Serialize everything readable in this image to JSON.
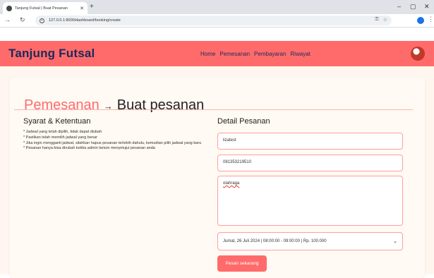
{
  "browser": {
    "tab_title": "Tanjung Futsal | Buat Pesanan",
    "tab_close": "✕",
    "new_tab": "+",
    "url": "127.0.0.1:8000/dashboard/booking/create",
    "controls": {
      "minimize": "–",
      "maximize": "▢",
      "close": "✕"
    }
  },
  "navbar": {
    "brand": "Tanjung Futsal",
    "menu": [
      "Home",
      "Pemesanan",
      "Pembayaran",
      "Riwayat"
    ],
    "accent_color": "#ff6b6b"
  },
  "page": {
    "breadcrumb_parent": "Pemesanan",
    "breadcrumb_arrow": "→",
    "breadcrumb_current": "Buat pesanan"
  },
  "terms": {
    "title": "Syarat & Ketentuan",
    "lines": [
      "* Jadwal yang telah dipilih, tidak dapat diubah",
      "* Pastikan telah memilih jadwal yang benar",
      "* Jika ingin mengganti jadwal, silahkan hapus pesanan terlebih dahulu, kemudian pilih jadwal yang baru",
      "* Pesanan hanya bisa dirubah ketika admin belum menyetujui pesanan anda"
    ]
  },
  "detail": {
    "title": "Detail Pesanan",
    "name_value": "lizatest",
    "phone_value": "081353219510",
    "note_value": "olahraga",
    "schedule_value": "Jumat, 26 Juli 2024 | 08:00:00 - 09:00:00 | Rp. 100.000",
    "submit_label": "Pesan sekarang"
  }
}
